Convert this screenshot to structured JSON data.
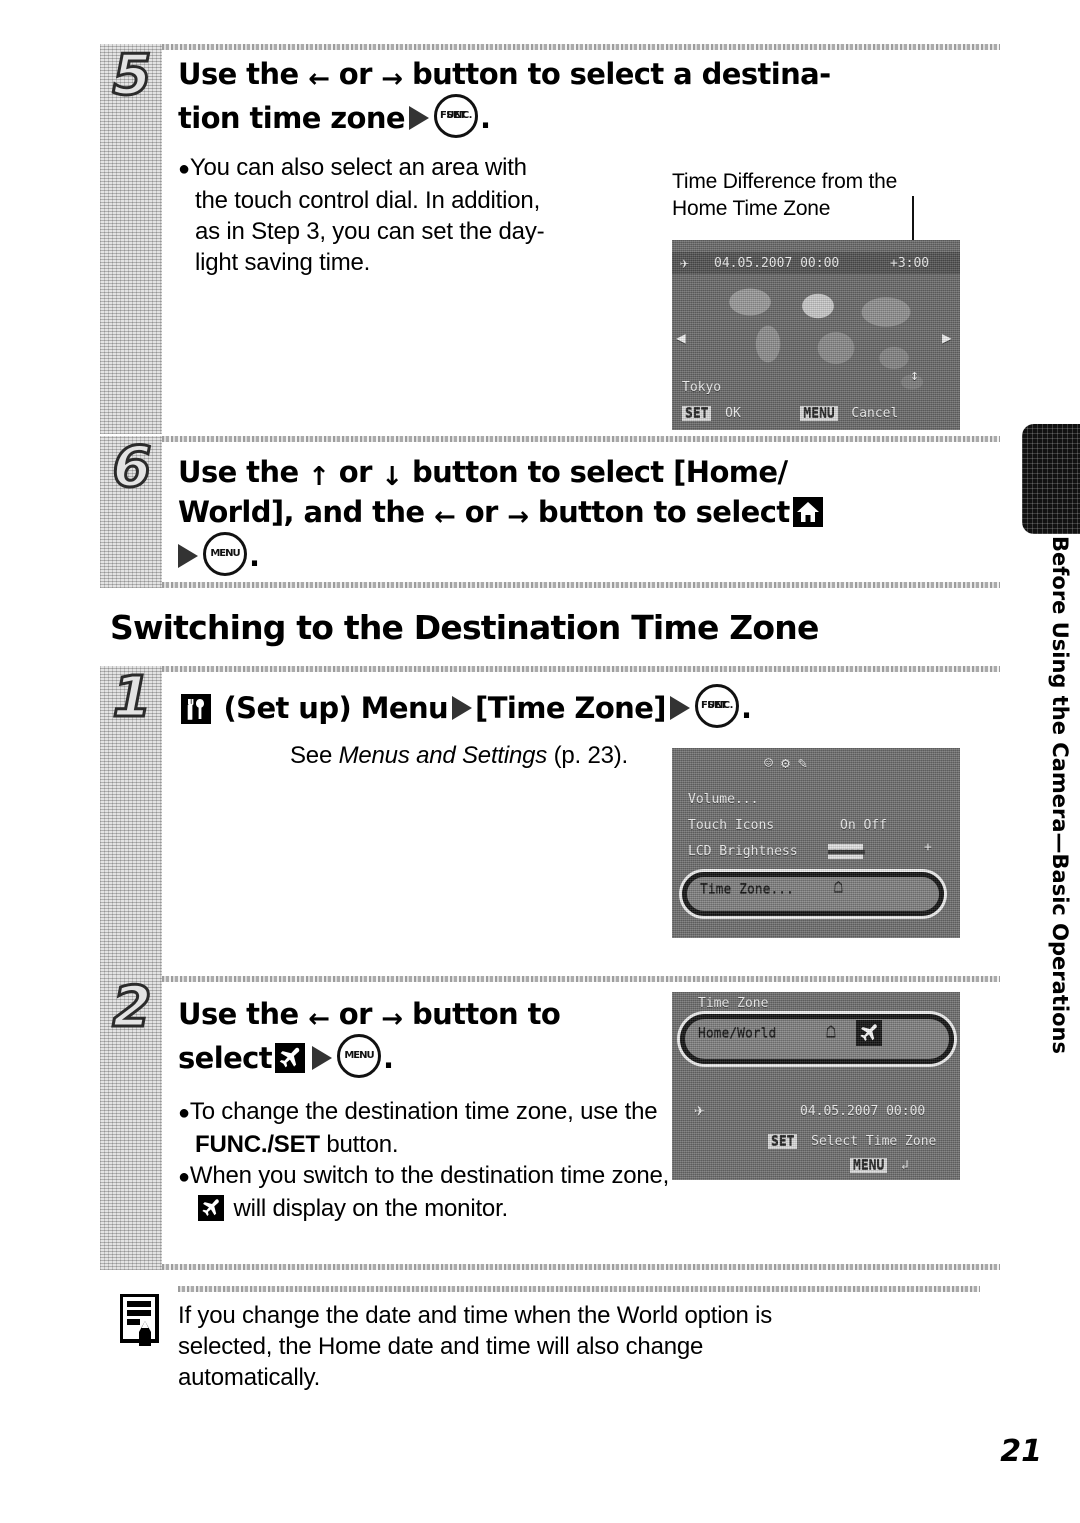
{
  "page": {
    "number": "21",
    "thumb_tab_label": "Before Using the Camera—Basic Operations"
  },
  "section": {
    "title": "Switching to the Destination Time Zone"
  },
  "steps": [
    {
      "number": "5",
      "heading_line1_a": "Use the",
      "heading_arrow_left": "←",
      "heading_or": "or",
      "heading_arrow_right": "→",
      "heading_line1_b": "button to select a destina-",
      "heading_line2": "tion time zone",
      "button_icon": "func-set-button-icon",
      "button_label_line1": "FUNC.",
      "button_label_line2": "SET",
      "period": ".",
      "bullets": [
        "You can also select an area with the touch control dial. In addition, as in Step 3, you can set the day-light saving time."
      ],
      "bullet_lines": [
        "You can also select an area with",
        "the touch control dial. In addition,",
        "as in Step 3, you can set the day-",
        "light saving time."
      ],
      "caption": "Time Difference from the Home Time Zone",
      "caption_lines": [
        "Time Difference from the",
        "Home Time Zone"
      ],
      "lcd": {
        "name": "time-zone-world-map-screen",
        "date_time": "04.05.2007 00:00",
        "time_difference": "+3:00",
        "city": "Tokyo",
        "hint_set": "SET",
        "hint_set_label": "OK",
        "hint_menu": "MENU",
        "hint_menu_label": "Cancel"
      }
    },
    {
      "number": "6",
      "heading_line1_a": "Use the",
      "heading_arrow_up": "↑",
      "heading_or": "or",
      "heading_arrow_down": "↓",
      "heading_line1_b": "button to select [Home/",
      "heading_line2_a": "World], and the",
      "heading_arrow_left": "←",
      "heading_line2_b": "or",
      "heading_arrow_right": "→",
      "heading_line2_c": "button to select",
      "home_icon": "home-icon",
      "button_icon": "menu-button-icon",
      "button_label": "MENU",
      "period": "."
    }
  ],
  "switching_steps": [
    {
      "number": "1",
      "setup_icon": "set-up-menu-icon",
      "heading_a": "(Set up) Menu",
      "heading_b": "[Time Zone]",
      "button_icon": "func-set-button-icon",
      "button_label_line1": "FUNC.",
      "button_label_line2": "SET",
      "period": ".",
      "see_prefix": "See ",
      "see_italic": "Menus and Settings",
      "see_suffix": " (p. 23).",
      "lcd": {
        "name": "set-up-menu-screen",
        "items": [
          {
            "label": "Volume...",
            "value": ""
          },
          {
            "label": "Touch Icons",
            "value": "On  Off"
          },
          {
            "label": "LCD Brightness",
            "value": "▬▬▬▬▬▬"
          },
          {
            "label": "Time Zone...",
            "value": "home-icon"
          }
        ],
        "selected_index": 3
      }
    },
    {
      "number": "2",
      "heading_line1_a": "Use the",
      "heading_arrow_left": "←",
      "heading_or": "or",
      "heading_arrow_right": "→",
      "heading_line1_b": "button to",
      "heading_line2": "select",
      "world_icon": "airplane-world-icon",
      "button_icon": "menu-button-icon",
      "button_label": "MENU",
      "period": ".",
      "bullet_lines_1": [
        "To change the destination time",
        "zone, use the FUNC./SET button."
      ],
      "bullet1_pre": "To change the destination time zone, use the ",
      "bullet1_bold": "FUNC./SET",
      "bullet1_post": " button.",
      "bullet2_pre": "When you switch to the destination time zone, ",
      "bullet2_icon": "airplane-world-icon",
      "bullet2_post": " will display on the monitor.",
      "lcd": {
        "name": "home-world-selection-screen",
        "title": "Time Zone",
        "row_label": "Home/World",
        "row_icon_home": "home-icon",
        "row_icon_world": "airplane-world-icon",
        "date_time": "04.05.2007 00:00",
        "hint_set": "SET",
        "hint_set_label": "Select Time Zone",
        "hint_menu": "MENU",
        "hint_menu_label": "↲"
      }
    }
  ],
  "note": {
    "icon": "memo-note-icon",
    "lines": [
      "If you change the date and time when the World option is",
      "selected, the Home date and time will also change",
      "automatically."
    ],
    "text": "If you change the date and time when the World option is selected, the Home date and time will also change automatically."
  },
  "colors": {
    "ink": "#000000",
    "gutter": "#e3e3e3",
    "lcd_bg": "#6f6f6f",
    "tab": "#111111"
  }
}
